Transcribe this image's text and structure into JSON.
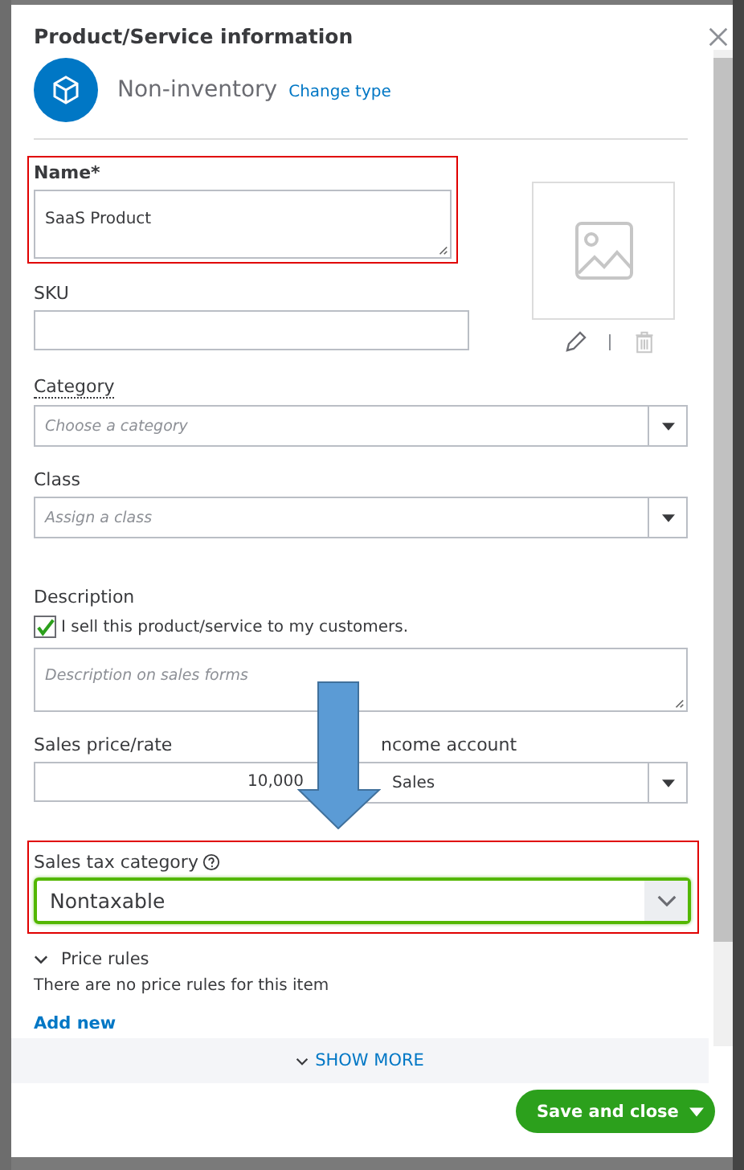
{
  "dialog": {
    "title": "Product/Service information"
  },
  "item_type": {
    "label": "Non-inventory",
    "link": "Change type"
  },
  "name_field": {
    "label": "Name*",
    "value": "SaaS Product",
    "highlighted": true
  },
  "sku_field": {
    "label": "SKU"
  },
  "category_field": {
    "label": "Category",
    "placeholder": "Choose a category"
  },
  "class_field": {
    "label": "Class",
    "placeholder": "Assign a class"
  },
  "description": {
    "label": "Description",
    "checkbox": {
      "label": "I sell this product/service to my customers.",
      "checked": true
    },
    "placeholder": "Description on sales forms"
  },
  "sales_price": {
    "label": "Sales price/rate",
    "value": "10,000"
  },
  "income_account": {
    "label": "ncome account",
    "value": "Sales"
  },
  "sales_tax_category": {
    "label": "Sales tax category",
    "value": "Nontaxable",
    "highlighted": true
  },
  "price_rules": {
    "label": "Price rules",
    "expanded": true,
    "message": "There are no price rules for this item",
    "link": "Add new"
  },
  "show_more": {
    "label": "SHOW MORE"
  },
  "save_button": {
    "label": "Save and close"
  }
}
